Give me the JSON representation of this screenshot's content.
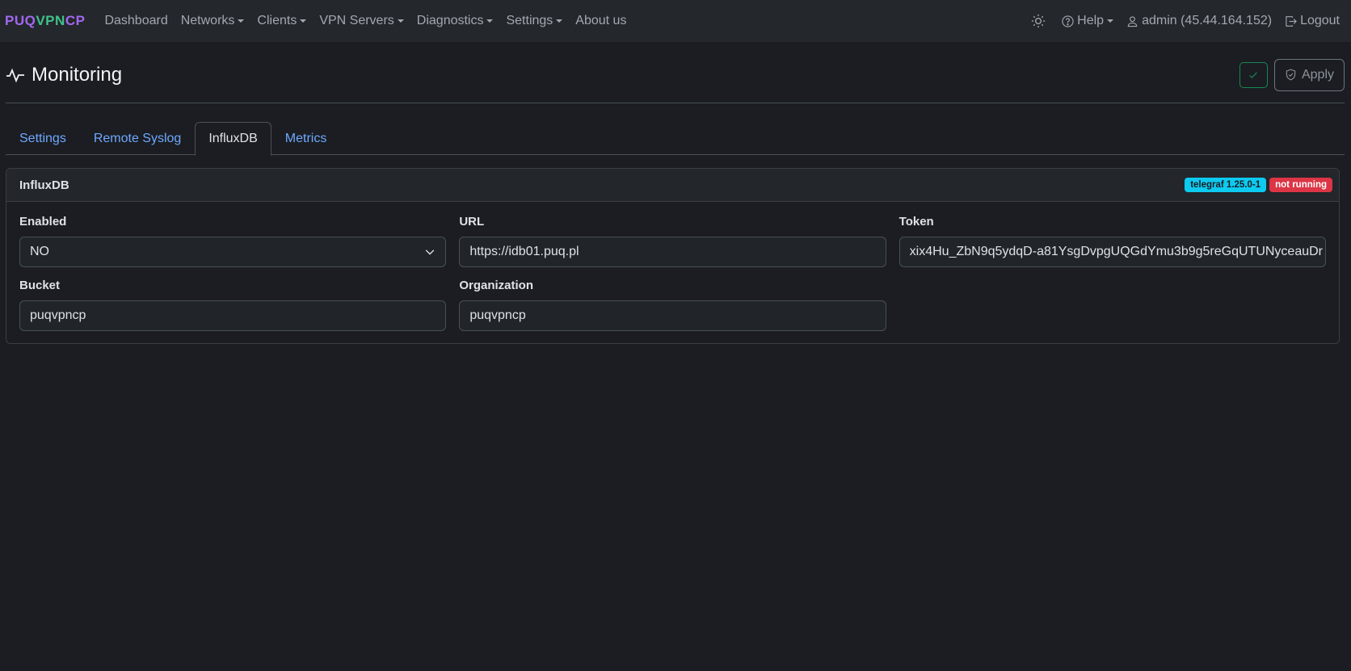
{
  "brand": {
    "p1": "PUQ",
    "p2": "VPN",
    "p3": "CP"
  },
  "nav": {
    "items": [
      {
        "label": "Dashboard",
        "caret": false
      },
      {
        "label": "Networks",
        "caret": true
      },
      {
        "label": "Clients",
        "caret": true
      },
      {
        "label": "VPN Servers",
        "caret": true
      },
      {
        "label": "Diagnostics",
        "caret": true
      },
      {
        "label": "Settings",
        "caret": true
      },
      {
        "label": "About us",
        "caret": false
      }
    ],
    "help": "Help",
    "user": "admin (45.44.164.152)",
    "logout": "Logout"
  },
  "page": {
    "title": "Monitoring",
    "apply": "Apply"
  },
  "tabs": [
    {
      "label": "Settings",
      "active": false
    },
    {
      "label": "Remote Syslog",
      "active": false
    },
    {
      "label": "InfluxDB",
      "active": true
    },
    {
      "label": "Metrics",
      "active": false
    }
  ],
  "card": {
    "title": "InfluxDB",
    "badge_version": "telegraf 1.25.0-1",
    "badge_status": "not running",
    "fields": {
      "enabled": {
        "label": "Enabled",
        "value": "NO"
      },
      "url": {
        "label": "URL",
        "value": "https://idb01.puq.pl"
      },
      "token": {
        "label": "Token",
        "value": "xix4Hu_ZbN9q5ydqD-a81YsgDvpgUQGdYmu3b9g5reGqUTUNyceauDr"
      },
      "bucket": {
        "label": "Bucket",
        "value": "puqvpncp"
      },
      "organization": {
        "label": "Organization",
        "value": "puqvpncp"
      }
    }
  },
  "colors": {
    "accent": "#6ea8fe",
    "brand_purple": "#a268f0",
    "brand_green": "#3fc28a",
    "badge_info": "#0dcaf0",
    "badge_danger": "#dc3545",
    "success": "#198754"
  }
}
